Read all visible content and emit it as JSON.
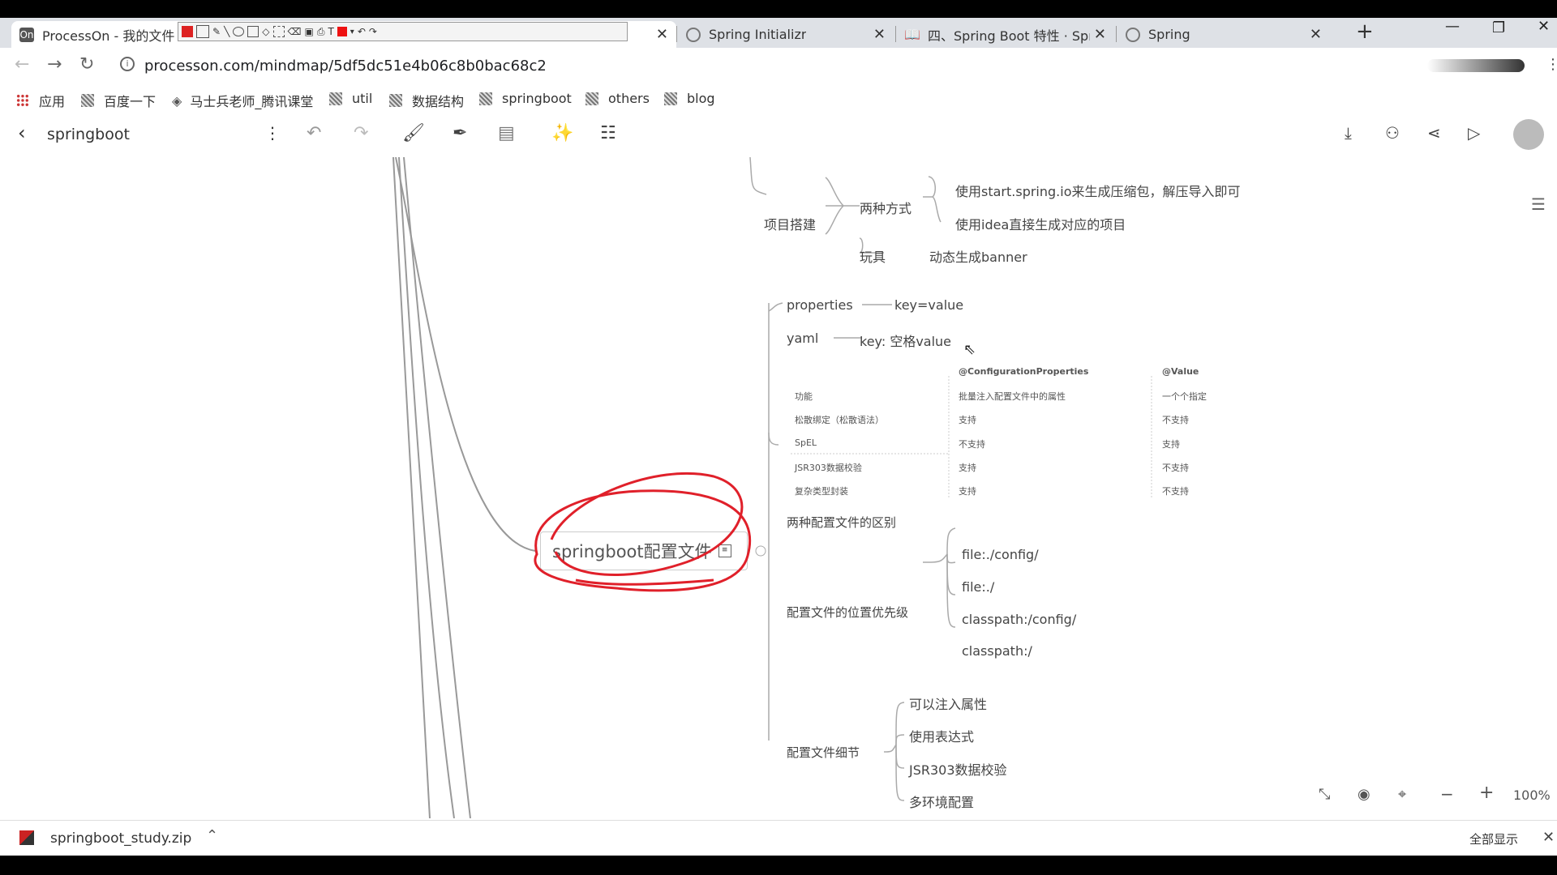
{
  "tabs": [
    {
      "title": "ProcessOn - 我的文件",
      "favicon": "processon-icon",
      "active": true
    },
    {
      "title": "Spring Initializr",
      "favicon": "spring-icon"
    },
    {
      "title": "四、Spring Boot 特性 · Spri",
      "favicon": "book-icon"
    },
    {
      "title": "Spring",
      "favicon": "spring-icon"
    }
  ],
  "new_tab": "+",
  "address": {
    "url": "processon.com/mindmap/5df5dc51e4b06c8b0bac68c2"
  },
  "bookmarks": [
    {
      "label": "应用",
      "icon": "apps-grid-icon"
    },
    {
      "label": "百度一下",
      "icon": "baidu-icon"
    },
    {
      "label": "马士兵老师_腾讯课堂",
      "icon": "tencent-icon"
    },
    {
      "label": "util",
      "icon": "folder-icon"
    },
    {
      "label": "数据结构",
      "icon": "folder-icon"
    },
    {
      "label": "springboot",
      "icon": "folder-icon"
    },
    {
      "label": "others",
      "icon": "folder-icon"
    },
    {
      "label": "blog",
      "icon": "folder-icon"
    }
  ],
  "app": {
    "title": "springboot"
  },
  "mindmap": {
    "project": {
      "label": "项目搭建",
      "ways": {
        "label": "两种方式",
        "items": [
          "使用start.spring.io来生成压缩包，解压导入即可",
          "使用idea直接生成对应的项目"
        ]
      },
      "toy": {
        "label": "玩具",
        "item": "动态生成banner"
      }
    },
    "central": "springboot配置文件",
    "properties": {
      "label": "properties",
      "value": "key=value"
    },
    "yaml": {
      "label": "yaml",
      "value": "key: 空格value"
    },
    "compare_table": {
      "headers": [
        "",
        "@ConfigurationProperties",
        "@Value"
      ],
      "rows": [
        [
          "功能",
          "批量注入配置文件中的属性",
          "一个个指定"
        ],
        [
          "松散绑定（松散语法）",
          "支持",
          "不支持"
        ],
        [
          "SpEL",
          "不支持",
          "支持"
        ],
        [
          "JSR303数据校验",
          "支持",
          "不支持"
        ],
        [
          "复杂类型封装",
          "支持",
          "不支持"
        ]
      ]
    },
    "diff_label": "两种配置文件的区别",
    "priority": {
      "label": "配置文件的位置优先级",
      "items": [
        "file:./config/",
        "file:./",
        "classpath:/config/",
        "classpath:/"
      ]
    },
    "details": {
      "label": "配置文件细节",
      "items": [
        "可以注入属性",
        "使用表达式",
        "JSR303数据校验",
        "多环境配置"
      ]
    }
  },
  "zoom": {
    "level": "100%",
    "minus": "−",
    "plus": "+"
  },
  "download": {
    "filename": "springboot_study.zip",
    "show_all": "全部显示"
  },
  "colors": {
    "annotation": "#e0202a",
    "tabstrip": "#dee1e6",
    "branch": "#999999"
  }
}
